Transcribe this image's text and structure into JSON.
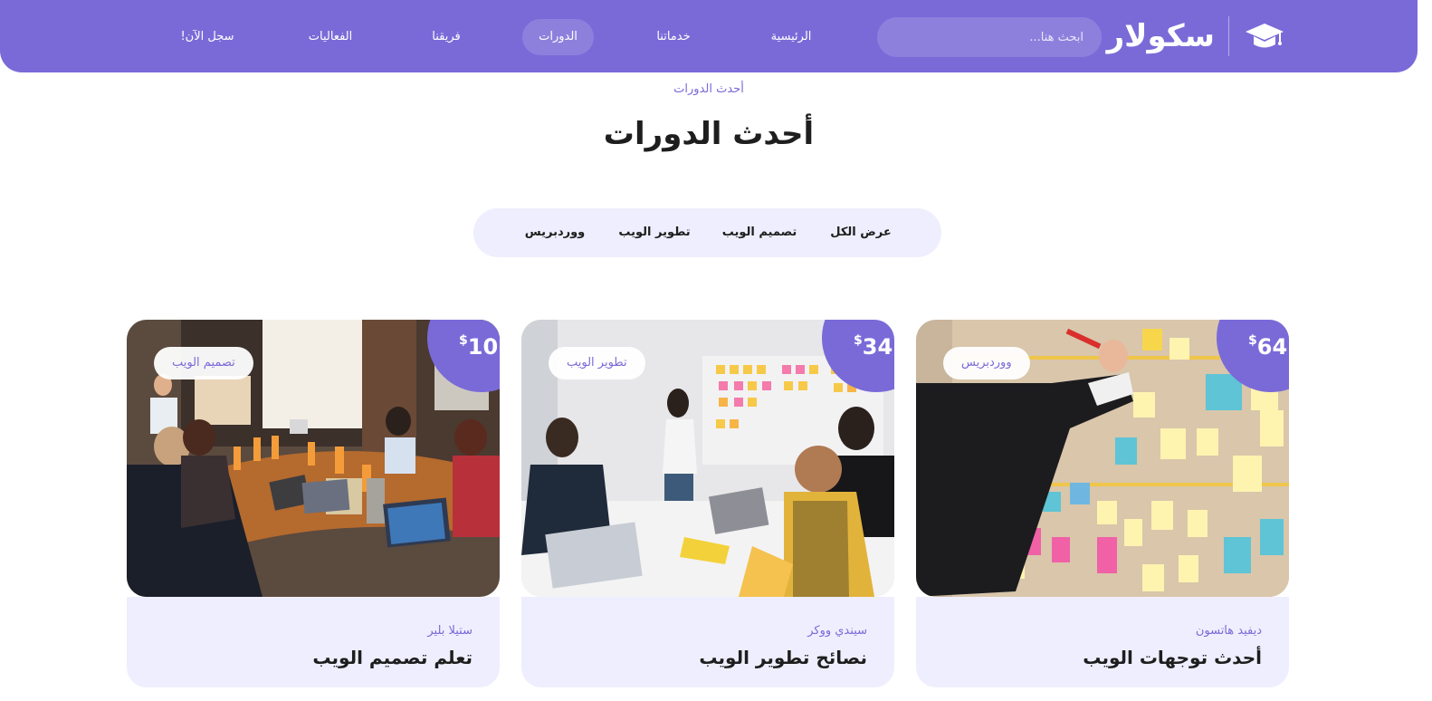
{
  "header": {
    "logo_text": "سكولار",
    "search_placeholder": "ابحث هنا...",
    "nav": [
      {
        "label": "الرئيسية",
        "active": false
      },
      {
        "label": "خدماتنا",
        "active": false
      },
      {
        "label": "الدورات",
        "active": true
      },
      {
        "label": "فريقنا",
        "active": false
      },
      {
        "label": "الفعاليات",
        "active": false
      },
      {
        "label": "سجل الآن!",
        "active": false
      }
    ]
  },
  "section": {
    "subtitle": "أحدث الدورات",
    "title": "أحدث الدورات"
  },
  "filters": [
    {
      "label": "عرض الكل"
    },
    {
      "label": "تصميم الويب"
    },
    {
      "label": "تطوير الويب"
    },
    {
      "label": "ووردبريس"
    }
  ],
  "courses": [
    {
      "tag": "ووردبريس",
      "price_currency": "$",
      "price_value": "64",
      "author": "ديفيد هاتسون",
      "title": "أحدث توجهات الويب"
    },
    {
      "tag": "تطوير الويب",
      "price_currency": "$",
      "price_value": "34",
      "author": "سيندي ووكر",
      "title": "نصائح تطوير الويب"
    },
    {
      "tag": "تصميم الويب",
      "price_currency": "$",
      "price_value": "10",
      "author": "ستيلا بلير",
      "title": "تعلم تصميم الويب"
    }
  ],
  "colors": {
    "accent": "#7a6ad8",
    "light_bg": "#efeefe",
    "text_dark": "#1e1e1e"
  },
  "icons": {
    "logo": "graduation-cap-icon"
  }
}
